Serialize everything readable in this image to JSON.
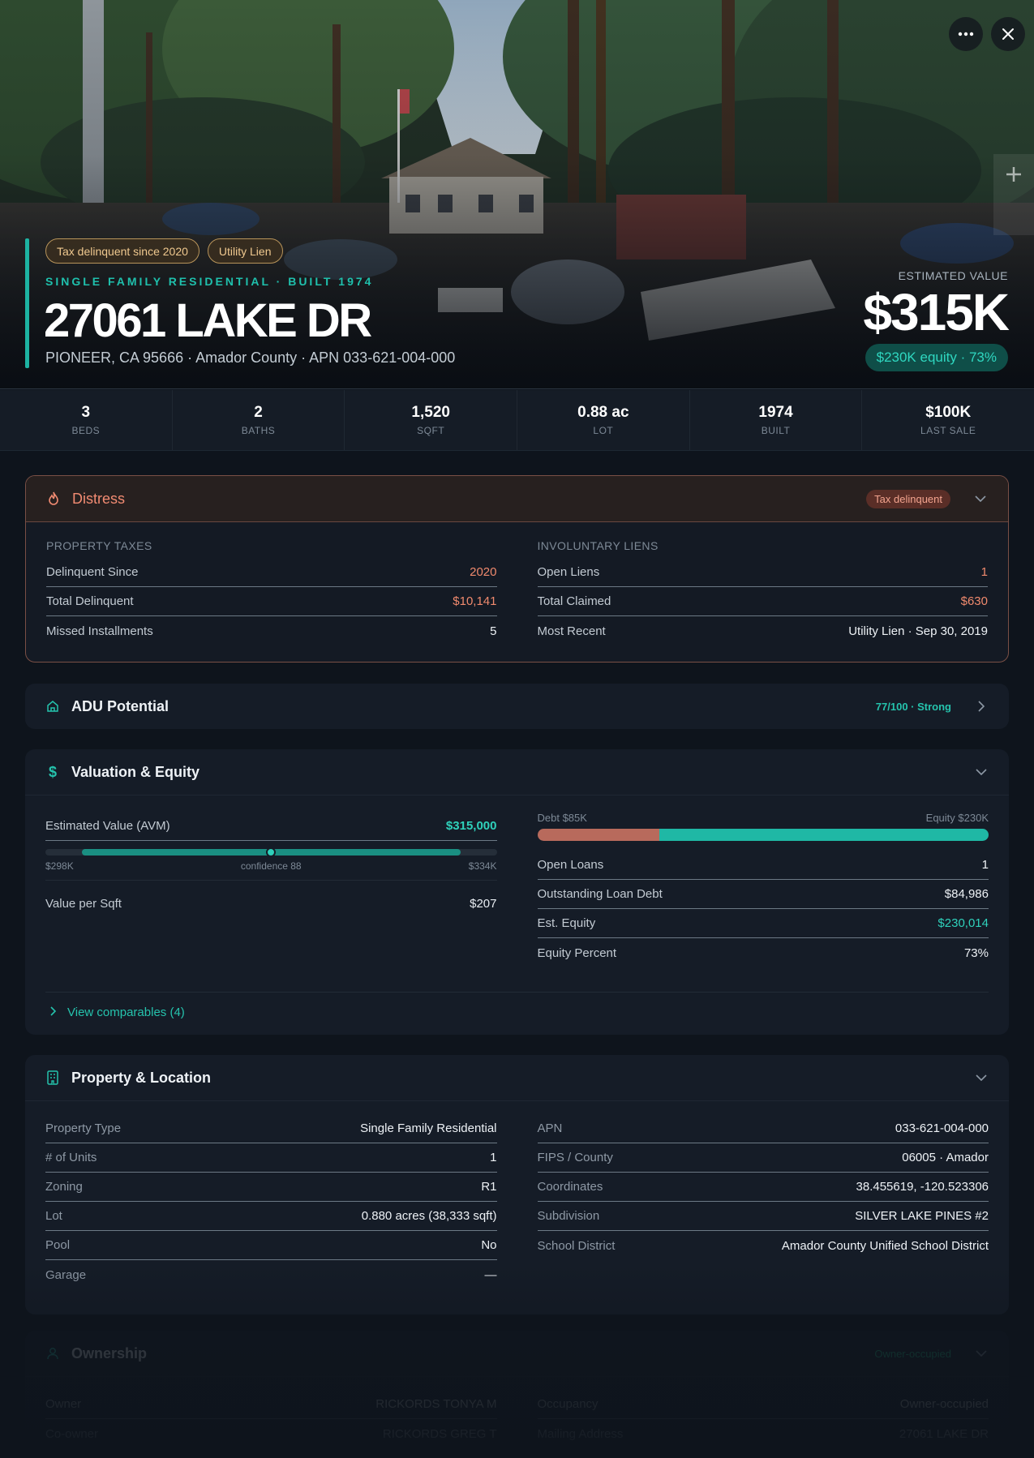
{
  "hero": {
    "more_icon": "more-horizontal-icon",
    "close_icon": "close-icon",
    "zoom_icon": "plus-icon",
    "chips": [
      "Tax delinquent since 2020",
      "Utility Lien"
    ],
    "eyebrow": "SINGLE FAMILY RESIDENTIAL · BUILT 1974",
    "address": "27061 LAKE DR",
    "subaddress": "PIONEER, CA 95666 · Amador County · APN 033-621-004-000",
    "est_label": "ESTIMATED VALUE",
    "est_value": "$315K",
    "equity_pill": "$230K equity · 73%"
  },
  "stats": [
    {
      "value": "3",
      "label": "BEDS"
    },
    {
      "value": "2",
      "label": "BATHS"
    },
    {
      "value": "1,520",
      "label": "SQFT"
    },
    {
      "value": "0.88 ac",
      "label": "LOT"
    },
    {
      "value": "1974",
      "label": "BUILT"
    },
    {
      "value": "$100K",
      "label": "LAST SALE"
    }
  ],
  "distress": {
    "title": "Distress",
    "badge": "Tax delinquent",
    "left_label": "PROPERTY TAXES",
    "left_rows": [
      {
        "k": "Delinquent Since",
        "v": "2020"
      },
      {
        "k": "Total Delinquent",
        "v": "$10,141"
      },
      {
        "k": "Missed Installments",
        "v": "5"
      }
    ],
    "right_label": "INVOLUNTARY LIENS",
    "right_rows": [
      {
        "k": "Open Liens",
        "v": "1"
      },
      {
        "k": "Total Claimed",
        "v": "$630"
      },
      {
        "k": "Most Recent",
        "v": "Utility Lien · Sep 30, 2019"
      }
    ]
  },
  "adu": {
    "title": "ADU Potential",
    "score": "77/100 · Strong"
  },
  "valuation": {
    "title": "Valuation & Equity",
    "avm_label": "Estimated Value (AVM)",
    "avm_value": "$315,000",
    "range_low": "$298K",
    "range_mid": "confidence 88",
    "range_high": "$334K",
    "vps_label": "Value per Sqft",
    "vps_value": "$207",
    "debt_label": "Debt $85K",
    "equity_label": "Equity $230K",
    "equity_share": 0.73,
    "rows": [
      {
        "k": "Open Loans",
        "v": "1"
      },
      {
        "k": "Outstanding Loan Debt",
        "v": "$84,986"
      },
      {
        "k": "Est. Equity",
        "v": "$230,014"
      },
      {
        "k": "Equity Percent",
        "v": "73%"
      }
    ],
    "comps_label": "View comparables (4)"
  },
  "property": {
    "title": "Property & Location",
    "left_rows": [
      {
        "k": "Property Type",
        "v": "Single Family Residential"
      },
      {
        "k": "# of Units",
        "v": "1"
      },
      {
        "k": "Zoning",
        "v": "R1"
      },
      {
        "k": "Lot",
        "v": "0.880 acres (38,333 sqft)"
      },
      {
        "k": "Pool",
        "v": "No"
      },
      {
        "k": "Garage",
        "v": "—"
      }
    ],
    "right_rows": [
      {
        "k": "APN",
        "v": "033-621-004-000"
      },
      {
        "k": "FIPS / County",
        "v": "06005 · Amador"
      },
      {
        "k": "Coordinates",
        "v": "38.455619, -120.523306"
      },
      {
        "k": "Subdivision",
        "v": "SILVER LAKE PINES #2"
      },
      {
        "k": "School District",
        "v": "Amador County Unified School District"
      }
    ]
  },
  "ownership": {
    "title": "Ownership",
    "badge": "Owner-occupied",
    "left_rows": [
      {
        "k": "Owner",
        "v": "RICKORDS TONYA M"
      },
      {
        "k": "Co-owner",
        "v": "RICKORDS GREG T"
      }
    ],
    "right_rows": [
      {
        "k": "Occupancy",
        "v": "Owner-occupied"
      },
      {
        "k": "Mailing Address",
        "v": "27061 LAKE DR"
      }
    ]
  }
}
